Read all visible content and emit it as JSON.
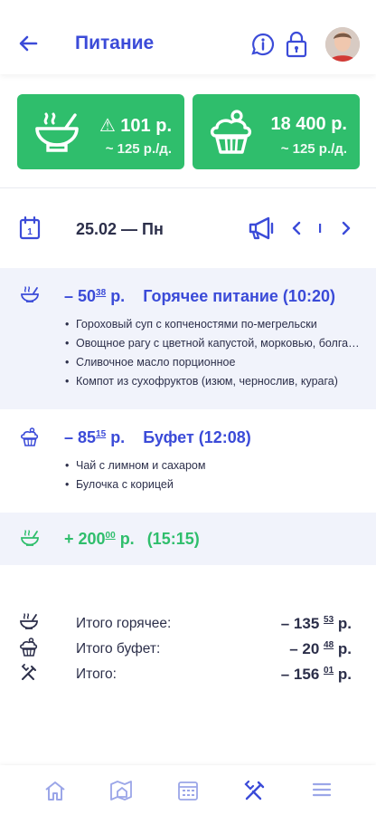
{
  "header": {
    "title": "Питание"
  },
  "cards": [
    {
      "amount": "⚠ 101 р.",
      "rate": "~ 125 р./д.",
      "icon": "soup-bowl-icon"
    },
    {
      "amount": "18 400 р.",
      "rate": "~ 125 р./д.",
      "icon": "cupcake-icon"
    }
  ],
  "date_bar": {
    "date": "25.02 — Пн",
    "page": "I"
  },
  "meals": [
    {
      "sign": "– 50",
      "cents": "38",
      "currency": "р.",
      "title": "Горячее питание (10:20)",
      "items": [
        "Гороховый суп с копченостями по-мегрельски",
        "Овощное рагу с цветной капустой, морковью, болгарским перцем",
        "Сливочное масло порционное",
        "Компот из сухофруктов (изюм, чернослив, курага)"
      ]
    },
    {
      "sign": "– 85",
      "cents": "15",
      "currency": "р.",
      "title": "Буфет (12:08)",
      "items": [
        "Чай с лимном и сахаром",
        "Булочка с корицей"
      ]
    },
    {
      "sign": "+ 200",
      "cents": "00",
      "currency": "р.",
      "title": "(15:15)"
    }
  ],
  "totals": [
    {
      "label": "Итого горячее:",
      "value": "– 135",
      "cents": "53",
      "currency": "р."
    },
    {
      "label": "Итого буфет:",
      "value": "– 20",
      "cents": "48",
      "currency": "р."
    },
    {
      "label": "Итого:",
      "value": "– 156",
      "cents": "01",
      "currency": "р."
    }
  ],
  "colors": {
    "accent": "#3b4bd8",
    "green": "#2fbe6c",
    "block_bg": "#f1f3fb"
  }
}
